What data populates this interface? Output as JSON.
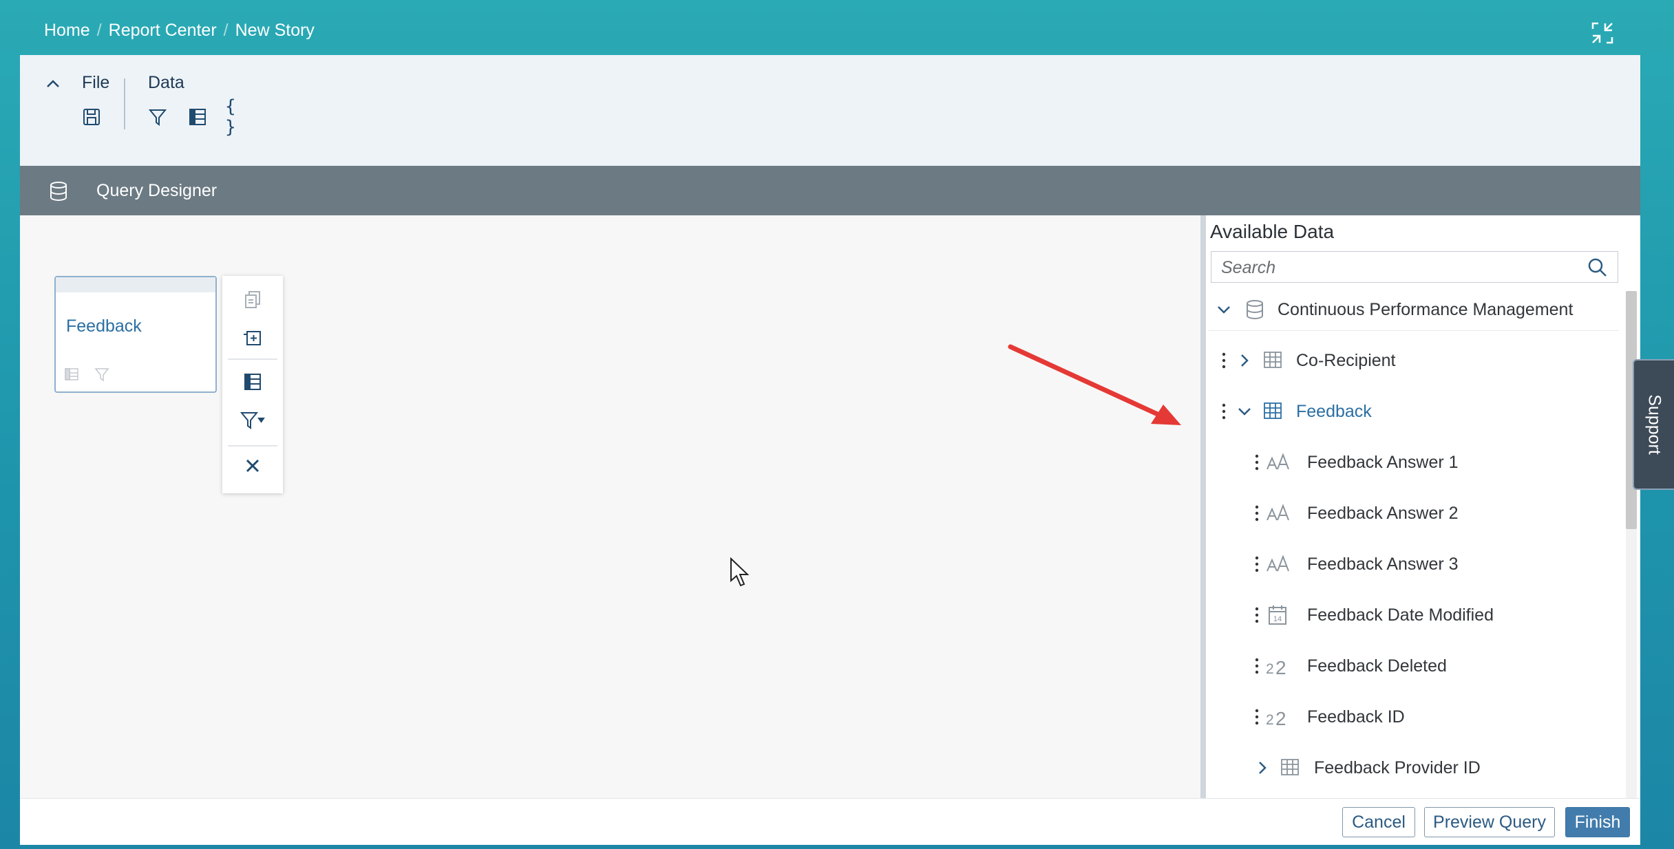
{
  "breadcrumb": {
    "items": [
      "Home",
      "Report Center",
      "New Story"
    ]
  },
  "toolbar": {
    "file_label": "File",
    "data_label": "Data"
  },
  "query_designer": {
    "title": "Query Designer"
  },
  "node": {
    "title": "Feedback"
  },
  "available_data": {
    "title": "Available Data",
    "search_placeholder": "Search",
    "root": "Continuous Performance Management",
    "items": [
      {
        "label": "Co-Recipient",
        "icon": "table-icon",
        "expanded": false
      },
      {
        "label": "Feedback",
        "icon": "table-icon",
        "expanded": true
      },
      {
        "label": "Feedback Answer 1",
        "icon": "text-type-icon"
      },
      {
        "label": "Feedback Answer 2",
        "icon": "text-type-icon"
      },
      {
        "label": "Feedback Answer 3",
        "icon": "text-type-icon"
      },
      {
        "label": "Feedback Date Modified",
        "icon": "calendar-icon"
      },
      {
        "label": "Feedback Deleted",
        "icon": "number-type-icon"
      },
      {
        "label": "Feedback ID",
        "icon": "number-type-icon"
      },
      {
        "label": "Feedback Provider ID",
        "icon": "table-icon",
        "expanded": false
      }
    ]
  },
  "footer": {
    "cancel": "Cancel",
    "preview": "Preview Query",
    "finish": "Finish"
  },
  "support": {
    "label": "Support"
  },
  "colors": {
    "accent": "#427cac",
    "header_bar": "#6c7a83",
    "annotation": "#e53935"
  }
}
